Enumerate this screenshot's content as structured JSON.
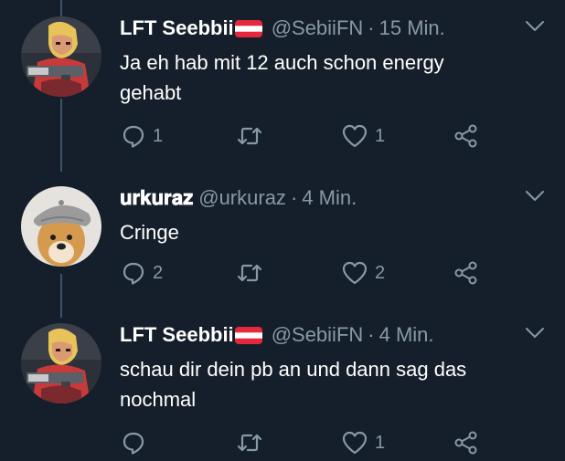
{
  "tweets": [
    {
      "display_name": "LFT Seebbii",
      "handle": "@SebiiFN",
      "separator": "·",
      "time": "15 Min.",
      "text_lines": [
        "Ja eh hab mit 12 auch schon energy",
        "gehabt"
      ],
      "reply_count": "1",
      "retweet_count": "",
      "like_count": "1",
      "avatar": "fortnite-skin-avatar",
      "flag": "austria-flag"
    },
    {
      "display_name": "𝐮𝐫𝐤𝐮𝐫𝐚𝐳",
      "handle": "@urkuraz",
      "separator": "·",
      "time": "4 Min.",
      "text_lines": [
        "Cringe"
      ],
      "reply_count": "2",
      "retweet_count": "",
      "like_count": "2",
      "avatar": "shiba-dog-beret-avatar",
      "flag": ""
    },
    {
      "display_name": "LFT Seebbii",
      "handle": "@SebiiFN",
      "separator": "·",
      "time": "4 Min.",
      "text_lines": [
        "schau dir dein pb an und dann sag das",
        "nochmal"
      ],
      "reply_count": "",
      "retweet_count": "",
      "like_count": "1",
      "avatar": "fortnite-skin-avatar",
      "flag": "austria-flag"
    }
  ],
  "icons": {
    "reply": "reply-icon",
    "retweet": "retweet-icon",
    "like": "heart-icon",
    "share": "share-icon",
    "menu": "chevron-down-icon"
  },
  "colors": {
    "background": "#151f2b",
    "text": "#ffffff",
    "secondary": "#8899a6",
    "thread_line": "#3d5466",
    "flag_red": "#e5283d"
  }
}
